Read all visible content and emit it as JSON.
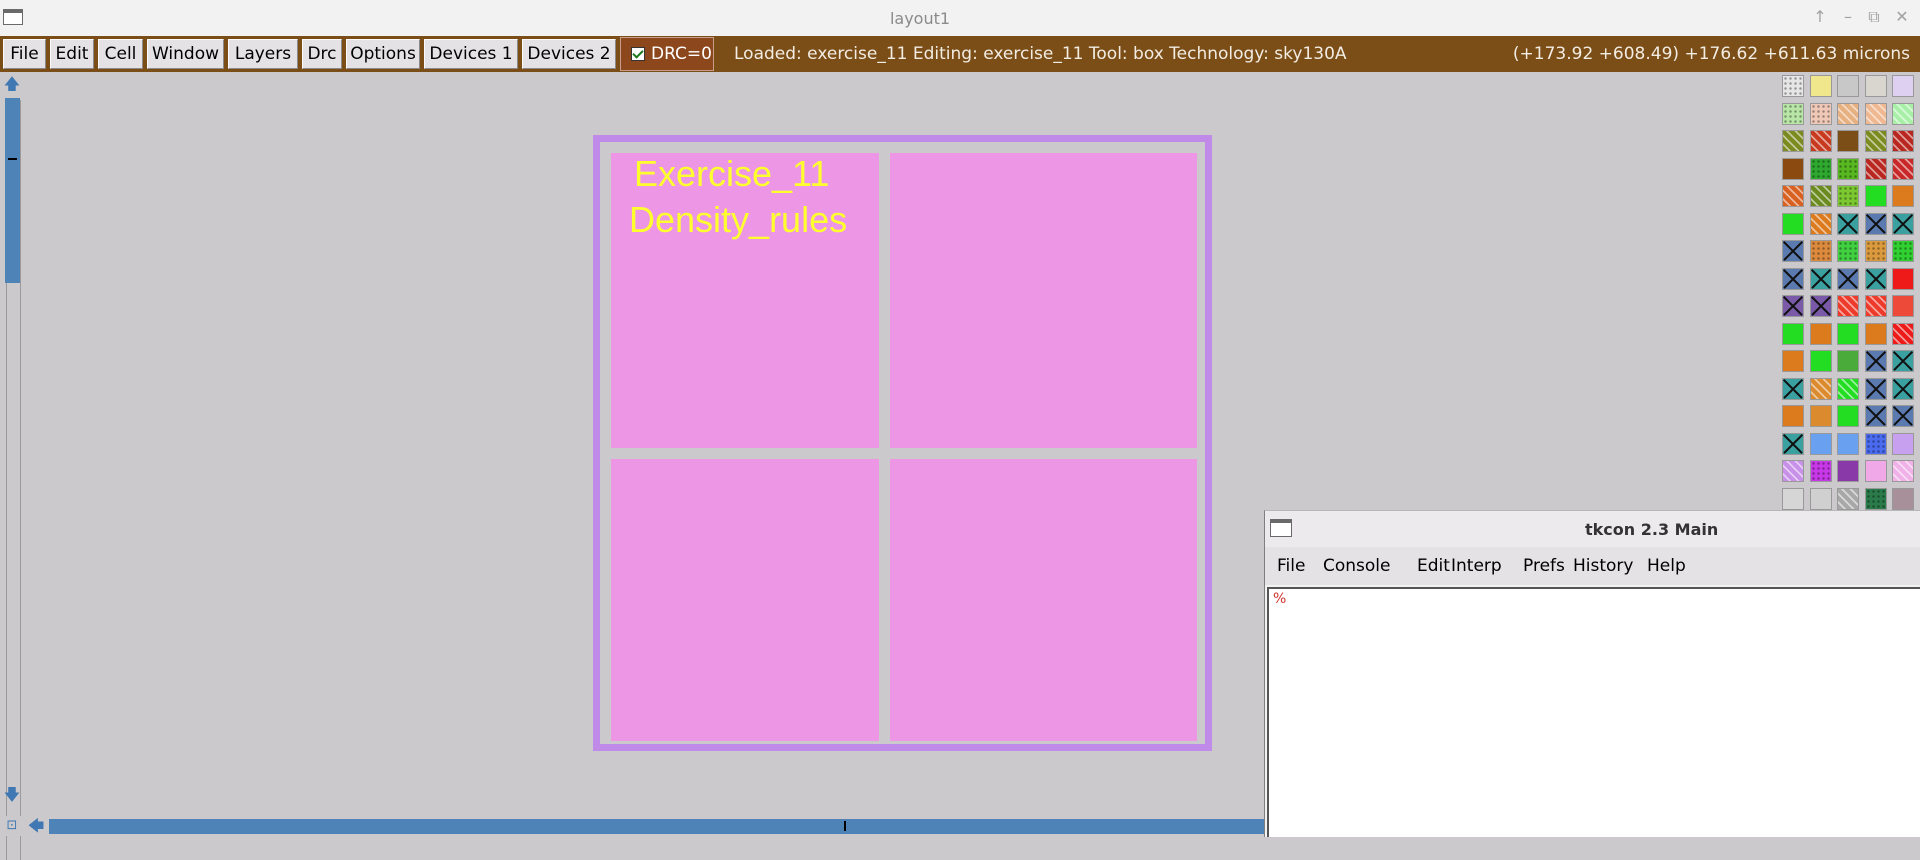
{
  "window": {
    "title": "layout1",
    "controls": [
      "↑",
      "–",
      "⧉",
      "✕"
    ]
  },
  "menubar": {
    "items": [
      "File",
      "Edit",
      "Cell",
      "Window",
      "Layers",
      "Drc",
      "Options",
      "Devices 1",
      "Devices 2"
    ],
    "drc": {
      "checked": true,
      "label": "DRC=0"
    },
    "status": "Loaded: exercise_11 Editing: exercise_11 Tool: box  Technology: sky130A",
    "coords": "(+173.92 +608.49) +176.62 +611.63 microns"
  },
  "layout": {
    "label_lines": [
      "Exercise_11",
      "Density_rules"
    ],
    "colors": {
      "frame": "#bf8ae8",
      "cell": "#ee96e6",
      "label": "#ffff2e",
      "menubar": "#7b4e18",
      "scroll": "#4e83b8"
    }
  },
  "scrollbars": {
    "up_icon": "arrow-up-icon",
    "down_icon": "arrow-down-icon",
    "left_icon": "arrow-left-icon",
    "zoom_icon": "zoom-box-icon"
  },
  "palette": {
    "rows": [
      [
        "#e6e6e6:dt",
        "#f0e68c",
        "#c8c8c8",
        "#d8d6ce",
        "#ddd0f0"
      ],
      [
        "#b8e6a6:dt",
        "#f0c8b8:dt",
        "#e6b080:st",
        "#f0b890:st",
        "#a8f0a8:st"
      ],
      [
        "#7b8b20:st",
        "#c83a20:st",
        "#7b4e18",
        "#7b8b20:st",
        "#b82820:st"
      ],
      [
        "#8b4a10",
        "#2ea82e:dt",
        "#58b820:dt",
        "#b82820:st",
        "#c82828:st"
      ],
      [
        "#d86020:st",
        "#6b8b20:st",
        "#7cc830:dt",
        "#22dd22",
        "#dc7a1e"
      ],
      [
        "#22dd22",
        "#dc7a1e:st",
        "#3aa0a0:x",
        "#5a7ab0:x",
        "#3aa0a0:x"
      ],
      [
        "#5a7ab0:x",
        "#dc8a3e:dt",
        "#40d040:dt",
        "#dc9a3e:dt",
        "#30d030:dt"
      ],
      [
        "#5a7ab0:x",
        "#3aa0a0:x",
        "#5a7ab0:x",
        "#3aa0a0:x",
        "#ee1a1a"
      ],
      [
        "#7a5aa8:x",
        "#7a5aa8:x",
        "#ee3a2a:st",
        "#ee3a2a:st",
        "#ee4a3a"
      ],
      [
        "#22dd22",
        "#dc7a1e",
        "#22dd22",
        "#dc7a1e",
        "#ee1a1a:st"
      ],
      [
        "#dc7a1e",
        "#22dd22",
        "#4aaa3a",
        "#5a7ab0:x",
        "#3aa0a0:x"
      ],
      [
        "#3aa0a0:x",
        "#dc8a2e:st",
        "#22dd22:st",
        "#5a7ab0:x",
        "#3aa0a0:x"
      ],
      [
        "#dc7a1e",
        "#dc8a2e",
        "#22dd22",
        "#5a7ab0:x",
        "#5a7ab0:x"
      ],
      [
        "#3aa0a0:x",
        "#6aa0f0",
        "#6aa0f0",
        "#4a6af0:dt",
        "#c8a0f0"
      ],
      [
        "#c890e8:st",
        "#c838e8:dt",
        "#8a3aa8",
        "#f0a8e8",
        "#f0b0e8:st"
      ],
      [
        "#d6d6d6",
        "#d0d0d0",
        "#a8a8a8:st",
        "#2a7a4a:dt",
        "#a8909a"
      ]
    ]
  },
  "tkcon": {
    "title": "tkcon 2.3 Main",
    "menu": [
      "File",
      "Console",
      "Edit",
      "Interp",
      "Prefs",
      "History",
      "Help"
    ],
    "prompt": "%"
  }
}
